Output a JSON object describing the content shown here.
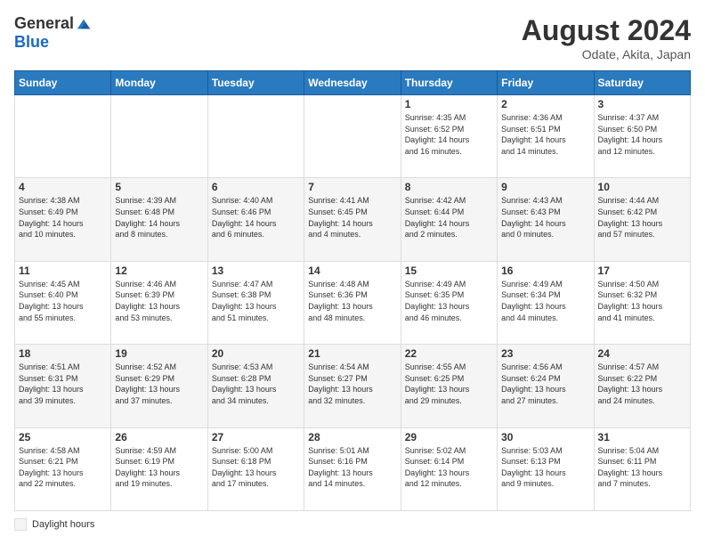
{
  "header": {
    "logo_general": "General",
    "logo_blue": "Blue",
    "month_year": "August 2024",
    "subtitle": "Odate, Akita, Japan"
  },
  "days_of_week": [
    "Sunday",
    "Monday",
    "Tuesday",
    "Wednesday",
    "Thursday",
    "Friday",
    "Saturday"
  ],
  "weeks": [
    [
      {
        "day": "",
        "info": ""
      },
      {
        "day": "",
        "info": ""
      },
      {
        "day": "",
        "info": ""
      },
      {
        "day": "",
        "info": ""
      },
      {
        "day": "1",
        "info": "Sunrise: 4:35 AM\nSunset: 6:52 PM\nDaylight: 14 hours\nand 16 minutes."
      },
      {
        "day": "2",
        "info": "Sunrise: 4:36 AM\nSunset: 6:51 PM\nDaylight: 14 hours\nand 14 minutes."
      },
      {
        "day": "3",
        "info": "Sunrise: 4:37 AM\nSunset: 6:50 PM\nDaylight: 14 hours\nand 12 minutes."
      }
    ],
    [
      {
        "day": "4",
        "info": "Sunrise: 4:38 AM\nSunset: 6:49 PM\nDaylight: 14 hours\nand 10 minutes."
      },
      {
        "day": "5",
        "info": "Sunrise: 4:39 AM\nSunset: 6:48 PM\nDaylight: 14 hours\nand 8 minutes."
      },
      {
        "day": "6",
        "info": "Sunrise: 4:40 AM\nSunset: 6:46 PM\nDaylight: 14 hours\nand 6 minutes."
      },
      {
        "day": "7",
        "info": "Sunrise: 4:41 AM\nSunset: 6:45 PM\nDaylight: 14 hours\nand 4 minutes."
      },
      {
        "day": "8",
        "info": "Sunrise: 4:42 AM\nSunset: 6:44 PM\nDaylight: 14 hours\nand 2 minutes."
      },
      {
        "day": "9",
        "info": "Sunrise: 4:43 AM\nSunset: 6:43 PM\nDaylight: 14 hours\nand 0 minutes."
      },
      {
        "day": "10",
        "info": "Sunrise: 4:44 AM\nSunset: 6:42 PM\nDaylight: 13 hours\nand 57 minutes."
      }
    ],
    [
      {
        "day": "11",
        "info": "Sunrise: 4:45 AM\nSunset: 6:40 PM\nDaylight: 13 hours\nand 55 minutes."
      },
      {
        "day": "12",
        "info": "Sunrise: 4:46 AM\nSunset: 6:39 PM\nDaylight: 13 hours\nand 53 minutes."
      },
      {
        "day": "13",
        "info": "Sunrise: 4:47 AM\nSunset: 6:38 PM\nDaylight: 13 hours\nand 51 minutes."
      },
      {
        "day": "14",
        "info": "Sunrise: 4:48 AM\nSunset: 6:36 PM\nDaylight: 13 hours\nand 48 minutes."
      },
      {
        "day": "15",
        "info": "Sunrise: 4:49 AM\nSunset: 6:35 PM\nDaylight: 13 hours\nand 46 minutes."
      },
      {
        "day": "16",
        "info": "Sunrise: 4:49 AM\nSunset: 6:34 PM\nDaylight: 13 hours\nand 44 minutes."
      },
      {
        "day": "17",
        "info": "Sunrise: 4:50 AM\nSunset: 6:32 PM\nDaylight: 13 hours\nand 41 minutes."
      }
    ],
    [
      {
        "day": "18",
        "info": "Sunrise: 4:51 AM\nSunset: 6:31 PM\nDaylight: 13 hours\nand 39 minutes."
      },
      {
        "day": "19",
        "info": "Sunrise: 4:52 AM\nSunset: 6:29 PM\nDaylight: 13 hours\nand 37 minutes."
      },
      {
        "day": "20",
        "info": "Sunrise: 4:53 AM\nSunset: 6:28 PM\nDaylight: 13 hours\nand 34 minutes."
      },
      {
        "day": "21",
        "info": "Sunrise: 4:54 AM\nSunset: 6:27 PM\nDaylight: 13 hours\nand 32 minutes."
      },
      {
        "day": "22",
        "info": "Sunrise: 4:55 AM\nSunset: 6:25 PM\nDaylight: 13 hours\nand 29 minutes."
      },
      {
        "day": "23",
        "info": "Sunrise: 4:56 AM\nSunset: 6:24 PM\nDaylight: 13 hours\nand 27 minutes."
      },
      {
        "day": "24",
        "info": "Sunrise: 4:57 AM\nSunset: 6:22 PM\nDaylight: 13 hours\nand 24 minutes."
      }
    ],
    [
      {
        "day": "25",
        "info": "Sunrise: 4:58 AM\nSunset: 6:21 PM\nDaylight: 13 hours\nand 22 minutes."
      },
      {
        "day": "26",
        "info": "Sunrise: 4:59 AM\nSunset: 6:19 PM\nDaylight: 13 hours\nand 19 minutes."
      },
      {
        "day": "27",
        "info": "Sunrise: 5:00 AM\nSunset: 6:18 PM\nDaylight: 13 hours\nand 17 minutes."
      },
      {
        "day": "28",
        "info": "Sunrise: 5:01 AM\nSunset: 6:16 PM\nDaylight: 13 hours\nand 14 minutes."
      },
      {
        "day": "29",
        "info": "Sunrise: 5:02 AM\nSunset: 6:14 PM\nDaylight: 13 hours\nand 12 minutes."
      },
      {
        "day": "30",
        "info": "Sunrise: 5:03 AM\nSunset: 6:13 PM\nDaylight: 13 hours\nand 9 minutes."
      },
      {
        "day": "31",
        "info": "Sunrise: 5:04 AM\nSunset: 6:11 PM\nDaylight: 13 hours\nand 7 minutes."
      }
    ]
  ],
  "footer": {
    "daylight_label": "Daylight hours"
  }
}
